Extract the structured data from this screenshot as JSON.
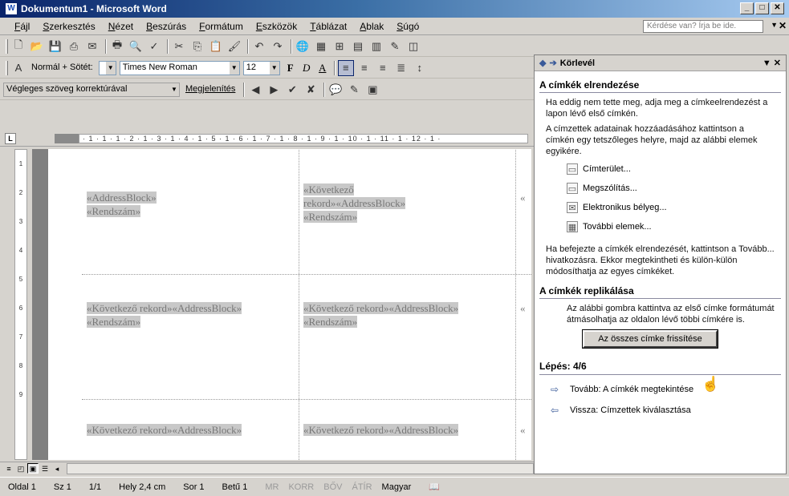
{
  "window": {
    "title": "Dokumentum1 - Microsoft Word"
  },
  "menu": [
    "Fájl",
    "Szerkesztés",
    "Nézet",
    "Beszúrás",
    "Formátum",
    "Eszközök",
    "Táblázat",
    "Ablak",
    "Súgó"
  ],
  "help_box": {
    "placeholder": "Kérdése van? Írja be ide."
  },
  "formatting": {
    "style": "Normál + Sötét:",
    "font": "Times New Roman",
    "size": "12",
    "bold": "F",
    "italic": "D",
    "underline": "A"
  },
  "reviewing": {
    "mode": "Végleges szöveg korrektúrával",
    "show": "Megjelenítés"
  },
  "ruler": {
    "corner": "L",
    "ticks": "· 1 · 1 · 1 · 2 · 1 · 3 · 1 · 4 · 1 · 5 · 1 · 6 · 1 · 7 · 1 · 8 · 1 · 9 · 1 · 10 · 1 · 11 · 1 · 12 · 1 ·"
  },
  "vruler": [
    "1",
    "2",
    "3",
    "4",
    "5",
    "6",
    "7",
    "8",
    "9"
  ],
  "labels": {
    "r1c1_a": "«AddressBlock»",
    "r1c1_b": "«Rendszám»",
    "next_record": "«Következő rekord»",
    "address_block": "«AddressBlock»",
    "plate": "«Rendszám»",
    "partial": "«"
  },
  "taskpane": {
    "title": "Körlevél",
    "section1": "A címkék elrendezése",
    "intro1": "Ha eddig nem tette meg, adja meg a címkeelrendezést a lapon lévő első címkén.",
    "intro2": "A címzettek adatainak hozzáadásához kattintson a címkén egy tetszőleges helyre, majd az alábbi elemek egyikére.",
    "links": [
      "Címterület...",
      "Megszólítás...",
      "Elektronikus bélyeg...",
      "További elemek..."
    ],
    "after": "Ha befejezte a címkék elrendezését, kattintson a Tovább... hivatkozásra. Ekkor megtekintheti és külön-külön módosíthatja az egyes címkéket.",
    "section2": "A címkék replikálása",
    "replicate_text": "Az alábbi gombra kattintva az első címke formátumát átmásolhatja az oldalon lévő többi címkére is.",
    "update_button": "Az összes címke frissítése",
    "step": "Lépés: 4/6",
    "next": "Tovább: A címkék megtekintése",
    "back": "Vissza: Címzettek kiválasztása"
  },
  "status": {
    "page": "Oldal 1",
    "section": "Sz 1",
    "pages": "1/1",
    "position": "Hely 2,4 cm",
    "line": "Sor 1",
    "col": "Betű 1",
    "rec": "MR",
    "trk": "KORR",
    "ext": "BŐV",
    "ovr": "ÁTÍR",
    "language": "Magyar"
  }
}
